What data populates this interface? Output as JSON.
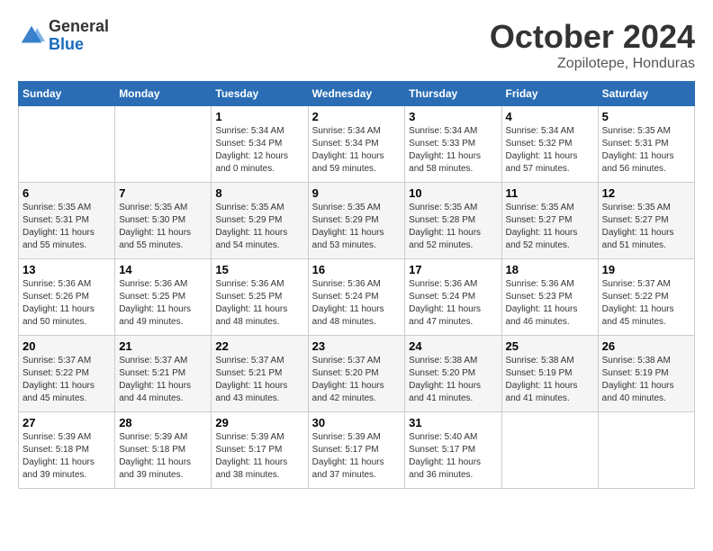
{
  "logo": {
    "general": "General",
    "blue": "Blue"
  },
  "title": "October 2024",
  "subtitle": "Zopilotepe, Honduras",
  "days_of_week": [
    "Sunday",
    "Monday",
    "Tuesday",
    "Wednesday",
    "Thursday",
    "Friday",
    "Saturday"
  ],
  "weeks": [
    [
      {
        "day": "",
        "info": ""
      },
      {
        "day": "",
        "info": ""
      },
      {
        "day": "1",
        "sunrise": "Sunrise: 5:34 AM",
        "sunset": "Sunset: 5:34 PM",
        "daylight": "Daylight: 12 hours and 0 minutes."
      },
      {
        "day": "2",
        "sunrise": "Sunrise: 5:34 AM",
        "sunset": "Sunset: 5:34 PM",
        "daylight": "Daylight: 11 hours and 59 minutes."
      },
      {
        "day": "3",
        "sunrise": "Sunrise: 5:34 AM",
        "sunset": "Sunset: 5:33 PM",
        "daylight": "Daylight: 11 hours and 58 minutes."
      },
      {
        "day": "4",
        "sunrise": "Sunrise: 5:34 AM",
        "sunset": "Sunset: 5:32 PM",
        "daylight": "Daylight: 11 hours and 57 minutes."
      },
      {
        "day": "5",
        "sunrise": "Sunrise: 5:35 AM",
        "sunset": "Sunset: 5:31 PM",
        "daylight": "Daylight: 11 hours and 56 minutes."
      }
    ],
    [
      {
        "day": "6",
        "sunrise": "Sunrise: 5:35 AM",
        "sunset": "Sunset: 5:31 PM",
        "daylight": "Daylight: 11 hours and 55 minutes."
      },
      {
        "day": "7",
        "sunrise": "Sunrise: 5:35 AM",
        "sunset": "Sunset: 5:30 PM",
        "daylight": "Daylight: 11 hours and 55 minutes."
      },
      {
        "day": "8",
        "sunrise": "Sunrise: 5:35 AM",
        "sunset": "Sunset: 5:29 PM",
        "daylight": "Daylight: 11 hours and 54 minutes."
      },
      {
        "day": "9",
        "sunrise": "Sunrise: 5:35 AM",
        "sunset": "Sunset: 5:29 PM",
        "daylight": "Daylight: 11 hours and 53 minutes."
      },
      {
        "day": "10",
        "sunrise": "Sunrise: 5:35 AM",
        "sunset": "Sunset: 5:28 PM",
        "daylight": "Daylight: 11 hours and 52 minutes."
      },
      {
        "day": "11",
        "sunrise": "Sunrise: 5:35 AM",
        "sunset": "Sunset: 5:27 PM",
        "daylight": "Daylight: 11 hours and 52 minutes."
      },
      {
        "day": "12",
        "sunrise": "Sunrise: 5:35 AM",
        "sunset": "Sunset: 5:27 PM",
        "daylight": "Daylight: 11 hours and 51 minutes."
      }
    ],
    [
      {
        "day": "13",
        "sunrise": "Sunrise: 5:36 AM",
        "sunset": "Sunset: 5:26 PM",
        "daylight": "Daylight: 11 hours and 50 minutes."
      },
      {
        "day": "14",
        "sunrise": "Sunrise: 5:36 AM",
        "sunset": "Sunset: 5:25 PM",
        "daylight": "Daylight: 11 hours and 49 minutes."
      },
      {
        "day": "15",
        "sunrise": "Sunrise: 5:36 AM",
        "sunset": "Sunset: 5:25 PM",
        "daylight": "Daylight: 11 hours and 48 minutes."
      },
      {
        "day": "16",
        "sunrise": "Sunrise: 5:36 AM",
        "sunset": "Sunset: 5:24 PM",
        "daylight": "Daylight: 11 hours and 48 minutes."
      },
      {
        "day": "17",
        "sunrise": "Sunrise: 5:36 AM",
        "sunset": "Sunset: 5:24 PM",
        "daylight": "Daylight: 11 hours and 47 minutes."
      },
      {
        "day": "18",
        "sunrise": "Sunrise: 5:36 AM",
        "sunset": "Sunset: 5:23 PM",
        "daylight": "Daylight: 11 hours and 46 minutes."
      },
      {
        "day": "19",
        "sunrise": "Sunrise: 5:37 AM",
        "sunset": "Sunset: 5:22 PM",
        "daylight": "Daylight: 11 hours and 45 minutes."
      }
    ],
    [
      {
        "day": "20",
        "sunrise": "Sunrise: 5:37 AM",
        "sunset": "Sunset: 5:22 PM",
        "daylight": "Daylight: 11 hours and 45 minutes."
      },
      {
        "day": "21",
        "sunrise": "Sunrise: 5:37 AM",
        "sunset": "Sunset: 5:21 PM",
        "daylight": "Daylight: 11 hours and 44 minutes."
      },
      {
        "day": "22",
        "sunrise": "Sunrise: 5:37 AM",
        "sunset": "Sunset: 5:21 PM",
        "daylight": "Daylight: 11 hours and 43 minutes."
      },
      {
        "day": "23",
        "sunrise": "Sunrise: 5:37 AM",
        "sunset": "Sunset: 5:20 PM",
        "daylight": "Daylight: 11 hours and 42 minutes."
      },
      {
        "day": "24",
        "sunrise": "Sunrise: 5:38 AM",
        "sunset": "Sunset: 5:20 PM",
        "daylight": "Daylight: 11 hours and 41 minutes."
      },
      {
        "day": "25",
        "sunrise": "Sunrise: 5:38 AM",
        "sunset": "Sunset: 5:19 PM",
        "daylight": "Daylight: 11 hours and 41 minutes."
      },
      {
        "day": "26",
        "sunrise": "Sunrise: 5:38 AM",
        "sunset": "Sunset: 5:19 PM",
        "daylight": "Daylight: 11 hours and 40 minutes."
      }
    ],
    [
      {
        "day": "27",
        "sunrise": "Sunrise: 5:39 AM",
        "sunset": "Sunset: 5:18 PM",
        "daylight": "Daylight: 11 hours and 39 minutes."
      },
      {
        "day": "28",
        "sunrise": "Sunrise: 5:39 AM",
        "sunset": "Sunset: 5:18 PM",
        "daylight": "Daylight: 11 hours and 39 minutes."
      },
      {
        "day": "29",
        "sunrise": "Sunrise: 5:39 AM",
        "sunset": "Sunset: 5:17 PM",
        "daylight": "Daylight: 11 hours and 38 minutes."
      },
      {
        "day": "30",
        "sunrise": "Sunrise: 5:39 AM",
        "sunset": "Sunset: 5:17 PM",
        "daylight": "Daylight: 11 hours and 37 minutes."
      },
      {
        "day": "31",
        "sunrise": "Sunrise: 5:40 AM",
        "sunset": "Sunset: 5:17 PM",
        "daylight": "Daylight: 11 hours and 36 minutes."
      },
      {
        "day": "",
        "info": ""
      },
      {
        "day": "",
        "info": ""
      }
    ]
  ]
}
